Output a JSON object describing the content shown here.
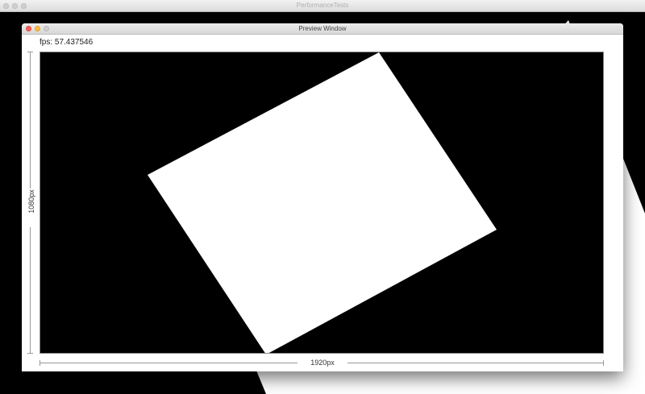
{
  "back_window": {
    "title": "PerformanceTests"
  },
  "preview_window": {
    "title": "Preview Window",
    "fps_text": "fps: 57.437546",
    "height_label": "1080px",
    "width_label": "1920px"
  },
  "colors": {
    "canvas_background": "#000000",
    "shape_fill": "#ffffff",
    "close_button": "#fc605b",
    "minimize_button": "#fdbc40",
    "zoom_button": "#cfcfcf"
  }
}
